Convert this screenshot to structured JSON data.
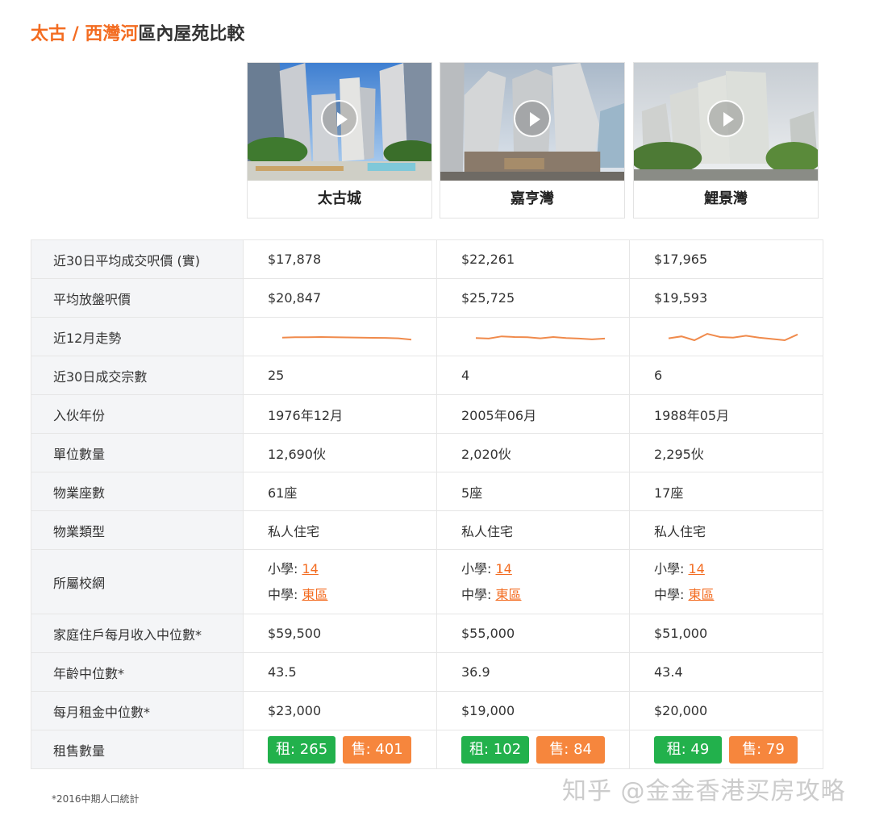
{
  "title": {
    "part1": "太古",
    "sep": " / ",
    "part2": "西灣河",
    "rest": "區內屋苑比較"
  },
  "estates": [
    {
      "name": "太古城",
      "photo_icon": "play-icon"
    },
    {
      "name": "嘉亨灣",
      "photo_icon": "play-icon"
    },
    {
      "name": "鯉景灣",
      "photo_icon": "play-icon"
    }
  ],
  "rows": {
    "avg_price": {
      "label": "近30日平均成交呎價 (實)",
      "values": [
        "$17,878",
        "$22,261",
        "$17,965"
      ]
    },
    "list_price": {
      "label": "平均放盤呎價",
      "values": [
        "$20,847",
        "$25,725",
        "$19,593"
      ]
    },
    "trend": {
      "label": "近12月走勢"
    },
    "transactions": {
      "label": "近30日成交宗數",
      "values": [
        "25",
        "4",
        "6"
      ]
    },
    "intake": {
      "label": "入伙年份",
      "values": [
        "1976年12月",
        "2005年06月",
        "1988年05月"
      ]
    },
    "units": {
      "label": "單位數量",
      "values": [
        "12,690伙",
        "2,020伙",
        "2,295伙"
      ]
    },
    "blocks": {
      "label": "物業座數",
      "values": [
        "61座",
        "5座",
        "17座"
      ]
    },
    "type": {
      "label": "物業類型",
      "values": [
        "私人住宅",
        "私人住宅",
        "私人住宅"
      ]
    },
    "school": {
      "label": "所屬校網",
      "primary_label": "小學: ",
      "secondary_label": "中學: ",
      "primary": [
        "14",
        "14",
        "14"
      ],
      "secondary": [
        "東區",
        "東區",
        "東區"
      ]
    },
    "income": {
      "label": "家庭住戶每月收入中位數*",
      "values": [
        "$59,500",
        "$55,000",
        "$51,000"
      ]
    },
    "age": {
      "label": "年齡中位數*",
      "values": [
        "43.5",
        "36.9",
        "43.4"
      ]
    },
    "rent": {
      "label": "每月租金中位數*",
      "values": [
        "$23,000",
        "$19,000",
        "$20,000"
      ]
    },
    "listings": {
      "label": "租售數量",
      "rent": [
        "租: 265",
        "租: 102",
        "租: 49"
      ],
      "sale": [
        "售: 401",
        "售: 84",
        "售: 79"
      ]
    }
  },
  "sparklines": [
    [
      0.55,
      0.52,
      0.52,
      0.5,
      0.52,
      0.53,
      0.55,
      0.56,
      0.57,
      0.6,
      0.7
    ],
    [
      0.58,
      0.62,
      0.45,
      0.5,
      0.52,
      0.6,
      0.5,
      0.58,
      0.62,
      0.68,
      0.62
    ],
    [
      0.6,
      0.45,
      0.75,
      0.25,
      0.5,
      0.55,
      0.4,
      0.55,
      0.65,
      0.75,
      0.3
    ]
  ],
  "colors": {
    "accent": "#f36c21",
    "rent_pill": "#22b14c",
    "sale_pill": "#f6863d",
    "label_bg": "#f4f5f7",
    "sparkline": "#f08a4b"
  },
  "footnote": "*2016中期人口統計",
  "watermark": "知乎 @金金香港买房攻略"
}
